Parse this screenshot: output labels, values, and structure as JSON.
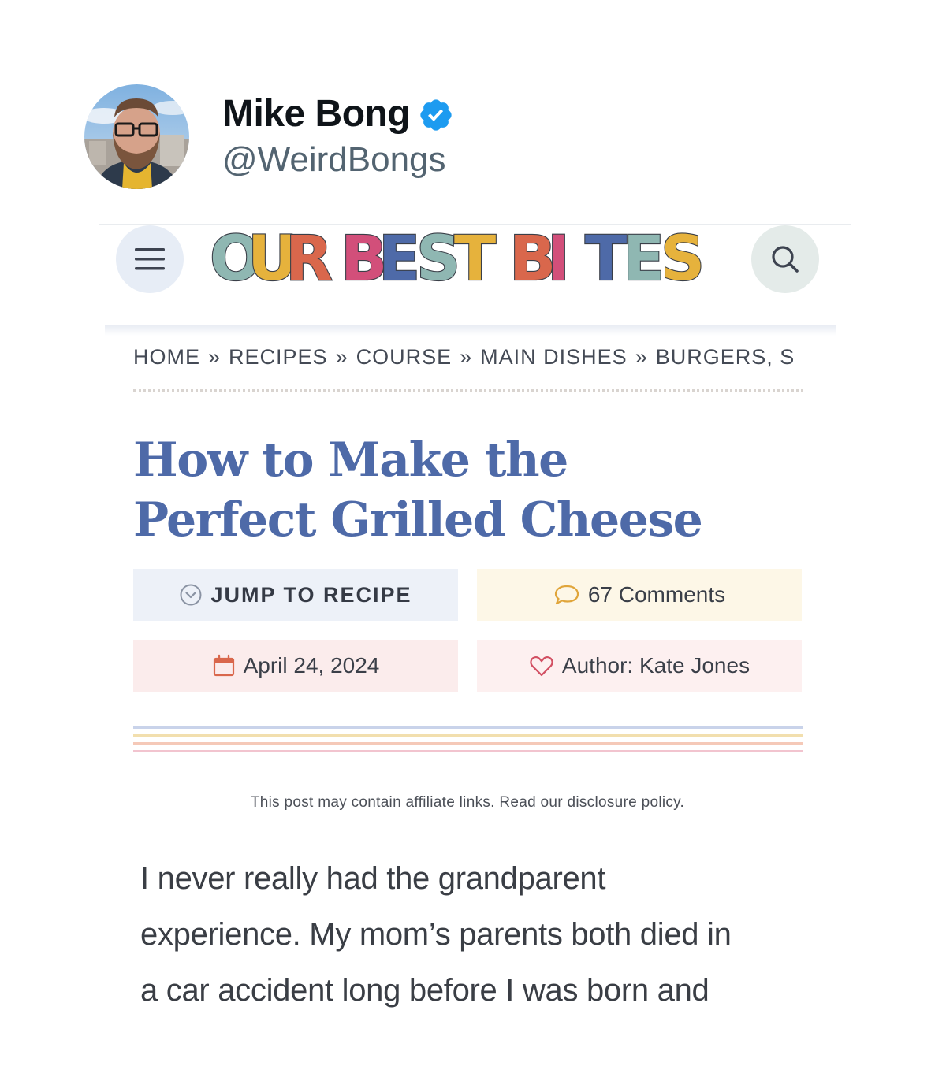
{
  "tweet": {
    "display_name": "Mike Bong",
    "handle": "@WeirdBongs"
  },
  "site": {
    "logo_words": [
      "OUR",
      "BEST",
      "BITES"
    ],
    "logo_letter_colors": [
      "#8fb7b2",
      "#e6b23c",
      "#d9674c",
      "#d24f7a",
      "#4e6aa8",
      "#8fb7b2",
      "#e6b23c",
      "#d9674c",
      "#d24f7a",
      "#4e6aa8",
      "#8fb7b2",
      "#e6b23c"
    ],
    "breadcrumb": [
      "HOME",
      "RECIPES",
      "COURSE",
      "MAIN DISHES",
      "BURGERS, S"
    ],
    "breadcrumb_separator": "»"
  },
  "post": {
    "title_line1": "How to Make the",
    "title_line2": "Perfect Grilled Cheese",
    "jump_label": "JUMP TO RECIPE",
    "comments_label": "67 Comments",
    "date_label": "April 24, 2024",
    "author_label": "Author: Kate Jones",
    "affiliate_note": "This post may contain affiliate links. Read our disclosure policy.",
    "body_line1": "I never really had the grandparent",
    "body_line2": "experience. My mom’s parents both died in",
    "body_line3": "a car accident long before I was born and"
  },
  "colors": {
    "verified_blue": "#1d9bf0",
    "title_blue": "#4e6aa8",
    "rainbow": [
      "#c9d3ea",
      "#f2dfae",
      "#f5c9b8",
      "#f2c4cf"
    ]
  }
}
